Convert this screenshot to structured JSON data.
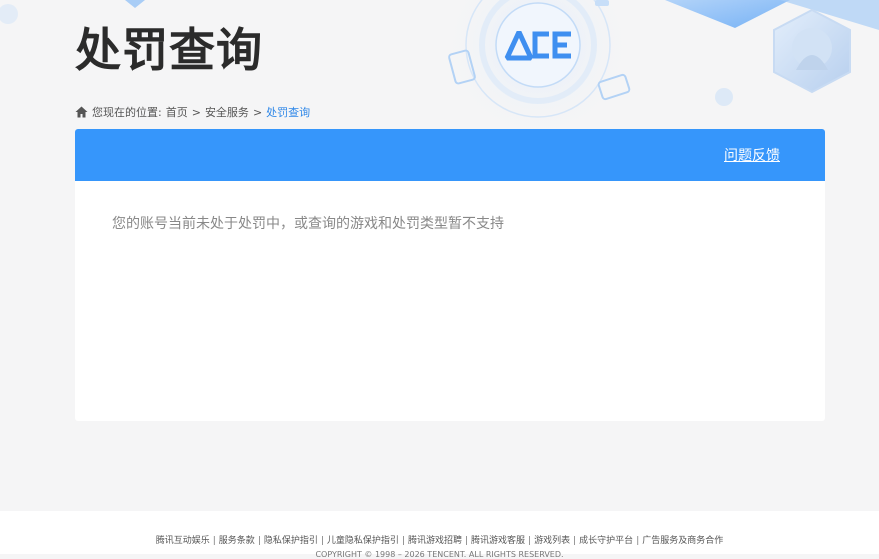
{
  "header": {
    "title": "处罚查询",
    "logo_text": "ACE"
  },
  "breadcrumb": {
    "prefix": "您现在的位置:",
    "items": [
      "首页",
      "安全服务"
    ],
    "current": "处罚查询",
    "separator": ">"
  },
  "panel": {
    "feedback_label": "问题反馈",
    "message": "您的账号当前未处于处罚中，或查询的游戏和处罚类型暂不支持"
  },
  "footer": {
    "links": [
      "腾讯互动娱乐",
      "服务条款",
      "隐私保护指引",
      "儿童隐私保护指引",
      "腾讯游戏招聘",
      "腾讯游戏客服",
      "游戏列表",
      "成长守护平台",
      "广告服务及商务合作"
    ],
    "copyright": "COPYRIGHT © 1998 – 2026 TENCENT. ALL RIGHTS RESERVED."
  },
  "colors": {
    "accent": "#3696fb",
    "current_breadcrumb": "#2e87e8",
    "page_bg": "#f5f5f6"
  },
  "icons": {
    "home": "home-icon",
    "logo": "ace-logo"
  }
}
